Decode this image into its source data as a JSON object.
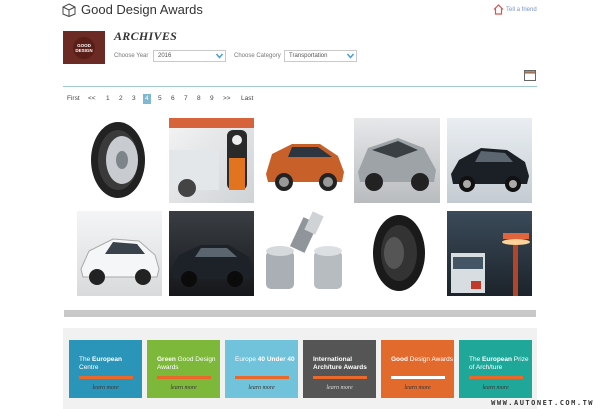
{
  "header": {
    "site_title": "Good Design Awards",
    "tell_friend": "Tell a friend"
  },
  "logo": {
    "line1": "GOOD",
    "line2": "DESIGN"
  },
  "archive": {
    "title": "ARCHIVES",
    "year_label": "Choose Year",
    "year_value": "2016",
    "category_label": "Choose Category",
    "category_value": "Transportation"
  },
  "pagination": {
    "first": "First",
    "prev": "<<",
    "pages": [
      "1",
      "2",
      "3",
      "4",
      "5",
      "6",
      "7",
      "8",
      "9"
    ],
    "current": "4",
    "next": ">>",
    "last": "Last"
  },
  "gallery": [
    {
      "name": "tire",
      "icon": "tire-icon"
    },
    {
      "name": "ev-charger",
      "icon": "charger-icon"
    },
    {
      "name": "orange-suv",
      "icon": "suv-icon"
    },
    {
      "name": "silver-concept-car",
      "icon": "car-icon"
    },
    {
      "name": "black-sedan",
      "icon": "sedan-icon"
    },
    {
      "name": "white-hatchback",
      "icon": "car-icon"
    },
    {
      "name": "dark-luxury-sedan",
      "icon": "sedan-icon"
    },
    {
      "name": "metal-bearing-parts",
      "icon": "bearing-icon"
    },
    {
      "name": "off-road-tire",
      "icon": "tire-icon"
    },
    {
      "name": "bus-and-streetlight",
      "icon": "bus-icon"
    }
  ],
  "promos": [
    {
      "pre": "The ",
      "bold": "European",
      "post": " Centre",
      "bg": "#2b95b9",
      "bar": "#e9692c",
      "more": "learn more"
    },
    {
      "pre": "",
      "bold": "Green",
      "post": " Good Design Awards",
      "bg": "#7db83a",
      "bar": "#e9692c",
      "more": "learn more"
    },
    {
      "pre": "Europe ",
      "bold": "40 Under 40",
      "post": "",
      "bg": "#70c3da",
      "bar": "#e9692c",
      "more": "learn more"
    },
    {
      "pre": "",
      "bold": "International Arch/ture Awards",
      "post": "",
      "bg": "#555555",
      "bar": "#e9692c",
      "more": "learn more"
    },
    {
      "pre": "",
      "bold": "Good",
      "post": " Design Awards",
      "bg": "#e26a2c",
      "bar": "#ffffff",
      "more": "learn more"
    },
    {
      "pre": "The ",
      "bold": "European",
      "post": " Prize of Arch/ture",
      "bg": "#1fa89a",
      "bar": "#e9692c",
      "more": "learn more"
    }
  ],
  "watermark": "WWW.AUTONET.COM.TW",
  "colors": {
    "accent": "#7fb8d0",
    "rule": "#9fc9d8",
    "logo_bg": "#6b2a23"
  }
}
